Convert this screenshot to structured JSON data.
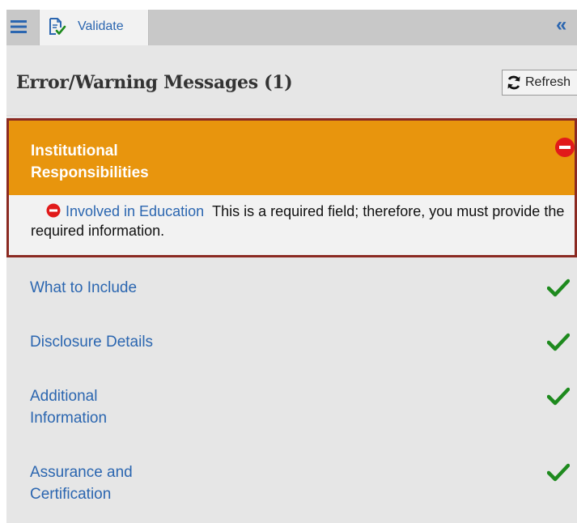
{
  "toolbar": {
    "menu_icon": "hamburger-icon",
    "tab_label": "Validate",
    "tab_icon": "validate-document-icon",
    "collapse_glyph": "«"
  },
  "header": {
    "title": "Error/Warning Messages (1)",
    "refresh_label": "Refresh"
  },
  "error_section": {
    "title": "Institutional Responsibilities",
    "status_icon": "error-icon",
    "message": {
      "field_link": "Involved in Education",
      "text": "This is a required field; therefore, you must provide the required information."
    }
  },
  "sections": [
    {
      "label": "What to Include",
      "status": "check-icon"
    },
    {
      "label": "Disclosure Details",
      "status": "check-icon"
    },
    {
      "label": "Additional Information",
      "status": "check-icon"
    },
    {
      "label": "Assurance and Certification",
      "status": "check-icon"
    }
  ],
  "colors": {
    "accent": "#2b66b0",
    "error_header": "#e8950d",
    "error_border": "#8b2a22",
    "error_icon": "#e11a1a",
    "success": "#1e8a1e"
  }
}
